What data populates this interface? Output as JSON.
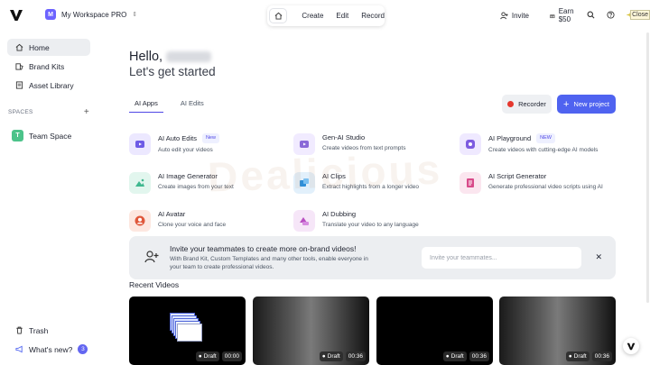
{
  "topbar": {
    "workspace_initial": "M",
    "workspace_name": "My Workspace PRO",
    "menu": [
      "Create",
      "Edit",
      "Record"
    ],
    "invite_label": "Invite",
    "earn_label": "Earn $50",
    "close_label": "Close"
  },
  "sidebar": {
    "items": [
      {
        "label": "Home",
        "icon": "home-icon"
      },
      {
        "label": "Brand Kits",
        "icon": "brand-kit-icon"
      },
      {
        "label": "Asset Library",
        "icon": "library-icon"
      }
    ],
    "spaces_label": "SPACES",
    "team_initial": "T",
    "team_label": "Team Space",
    "trash_label": "Trash",
    "whats_new_label": "What's new?",
    "whats_new_count": "3"
  },
  "main": {
    "hello": "Hello,",
    "subtitle": "Let's get started",
    "tabs": [
      "AI Apps",
      "AI Edits"
    ],
    "recorder_label": "Recorder",
    "new_project_label": "New project",
    "apps": [
      {
        "title": "AI Auto Edits",
        "tag": "New",
        "desc": "Auto edit your videos",
        "color": "#6e5be6"
      },
      {
        "title": "Gen-AI Studio",
        "tag": "",
        "desc": "Create videos from text prompts",
        "color": "#8a6ad8"
      },
      {
        "title": "AI Playground",
        "tag": "NEW",
        "desc": "Create videos with cutting-edge AI models",
        "color": "#7d5ce0"
      },
      {
        "title": "AI Image Generator",
        "tag": "",
        "desc": "Create images from your text",
        "color": "#3fb88f"
      },
      {
        "title": "AI Clips",
        "tag": "",
        "desc": "Extract highlights from a longer video",
        "color": "#2f8fd8"
      },
      {
        "title": "AI Script Generator",
        "tag": "",
        "desc": "Generate professional video scripts using AI",
        "color": "#d84b8a"
      },
      {
        "title": "AI Avatar",
        "tag": "",
        "desc": "Clone your voice and face",
        "color": "#e0583b"
      },
      {
        "title": "AI Dubbing",
        "tag": "",
        "desc": "Translate your video to any language",
        "color": "#b94fc2"
      }
    ],
    "invite": {
      "title": "Invite your teammates to create more on-brand videos!",
      "subtitle": "With Brand Kit, Custom Templates and many other tools, enable everyone in your team to create professional videos.",
      "placeholder": "Invite your teammates..."
    },
    "recent_label": "Recent Videos",
    "videos": [
      {
        "status": "Draft",
        "duration": "00:00"
      },
      {
        "status": "Draft",
        "duration": "00:36"
      },
      {
        "status": "Draft",
        "duration": "00:36"
      },
      {
        "status": "Draft",
        "duration": "00:36"
      }
    ]
  },
  "watermark": "Dealicious"
}
